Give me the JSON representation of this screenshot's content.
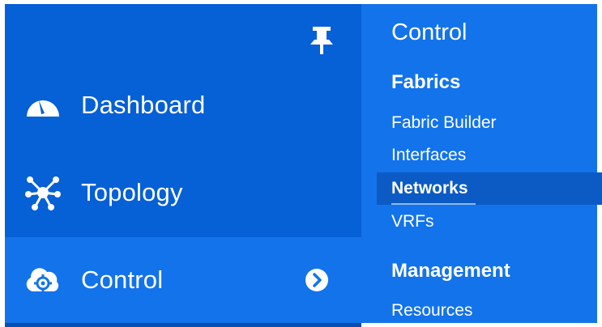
{
  "sidebar": {
    "items": [
      {
        "label": "Dashboard",
        "icon": "dashboard-gauge-icon"
      },
      {
        "label": "Topology",
        "icon": "topology-network-icon"
      },
      {
        "label": "Control",
        "icon": "control-cloud-gear-icon",
        "selected": true
      }
    ],
    "pin_icon": "pin-icon",
    "expand_icon": "chevron-right-circle-icon"
  },
  "flyout": {
    "title": "Control",
    "groups": [
      {
        "heading": "Fabrics",
        "items": [
          {
            "label": "Fabric Builder"
          },
          {
            "label": "Interfaces"
          },
          {
            "label": "Networks",
            "selected": true
          },
          {
            "label": "VRFs"
          }
        ]
      },
      {
        "heading": "Management",
        "items": [
          {
            "label": "Resources"
          }
        ]
      }
    ]
  },
  "colors": {
    "sidebar_bg": "#0660d6",
    "flyout_bg": "#1373ea",
    "selected_item_bg": "#0c5bc4",
    "text": "#ffffff"
  }
}
